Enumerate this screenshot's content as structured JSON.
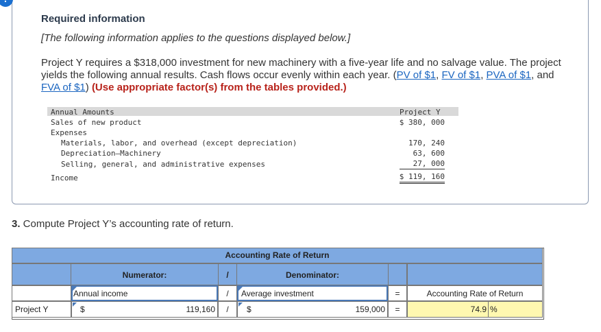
{
  "info": {
    "alert_glyph": "!",
    "title": "Required information",
    "subtitle": "[The following information applies to the questions displayed below.]",
    "para_main": "Project Y requires a $318,000 investment for new machinery with a five-year life and no salvage value. The project yields the following annual results. Cash flows occur evenly within each year. (",
    "link_pv": "PV of $1",
    "link_fv": "FV of $1",
    "link_pva": "PVA of $1",
    "link_fva": "FVA of $1",
    "sep1": ", ",
    "sep2": ", ",
    "sep3": ", and ",
    "close": ") ",
    "emphasis": "(Use appropriate factor(s) from the tables provided.)"
  },
  "annual_table": {
    "header_label": "Annual Amounts",
    "header_project": "Project Y",
    "rows": [
      {
        "label": "Sales of new product",
        "value": "$ 380, 000"
      },
      {
        "label": "Expenses",
        "value": ""
      },
      {
        "label": "Materials, labor, and overhead (except depreciation)",
        "value": "170, 240"
      },
      {
        "label": "Depreciation—Machinery",
        "value": "63, 600"
      },
      {
        "label": "Selling, general, and administrative expenses",
        "value": "27, 000"
      },
      {
        "label": "Income",
        "value": "$ 119, 160"
      }
    ]
  },
  "question": {
    "number": "3.",
    "text": " Compute Project Y’s accounting rate of return."
  },
  "arr_grid": {
    "title": "Accounting Rate of Return",
    "numerator_header": "Numerator:",
    "slash": "/",
    "denominator_header": "Denominator:",
    "numerator_label": "Annual income",
    "denominator_label": "Average investment",
    "equals": "=",
    "result_header": "Accounting Rate of Return",
    "row_label": "Project Y",
    "currency": "$",
    "numerator_value": "119,160",
    "denominator_value": "159,000",
    "result_value": "74.9",
    "percent": "%"
  },
  "colors": {
    "header_band": "#7ea9e1",
    "result_cell": "#fff8b0",
    "link": "#1a65c0",
    "emphasis": "#b8231b"
  }
}
